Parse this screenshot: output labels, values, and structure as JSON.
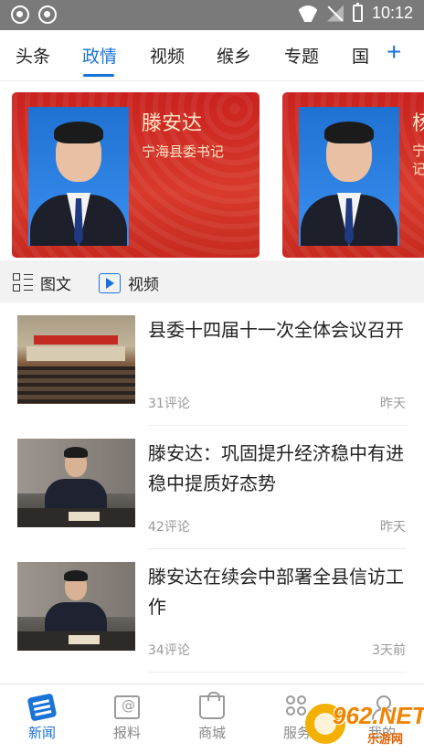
{
  "status_bar": {
    "time": "10:12"
  },
  "tabs": [
    {
      "label": "头条"
    },
    {
      "label": "政情"
    },
    {
      "label": "视频"
    },
    {
      "label": "缑乡"
    },
    {
      "label": "专题"
    },
    {
      "label": "国"
    }
  ],
  "active_tab": "政情",
  "add_tab_label": "+",
  "carousel": [
    {
      "name": "滕安达",
      "role": "宁海县委书记"
    },
    {
      "name": "杨",
      "role": "宁记"
    }
  ],
  "view_toggle": {
    "graphic_label": "图文",
    "video_label": "视频"
  },
  "news": [
    {
      "title": "县委十四届十一次全体会议召开",
      "comments": "31评论",
      "time": "昨天"
    },
    {
      "title": "滕安达：巩固提升经济稳中有进 稳中提质好态势",
      "comments": "42评论",
      "time": "昨天"
    },
    {
      "title": "滕安达在续会中部署全县信访工作",
      "comments": "34评论",
      "time": "3天前"
    }
  ],
  "bottom_nav": [
    {
      "label": "新闻",
      "icon": "news-icon"
    },
    {
      "label": "报料",
      "icon": "report-icon"
    },
    {
      "label": "商城",
      "icon": "mall-icon"
    },
    {
      "label": "服务",
      "icon": "service-icon"
    },
    {
      "label": "我的",
      "icon": "mine-icon"
    }
  ],
  "watermark": {
    "number": "962.NET",
    "sub": "乐游网"
  },
  "colors": {
    "accent": "#1a73d9",
    "card_red": "#d0281f",
    "status_bar": "#7a7a7a"
  }
}
